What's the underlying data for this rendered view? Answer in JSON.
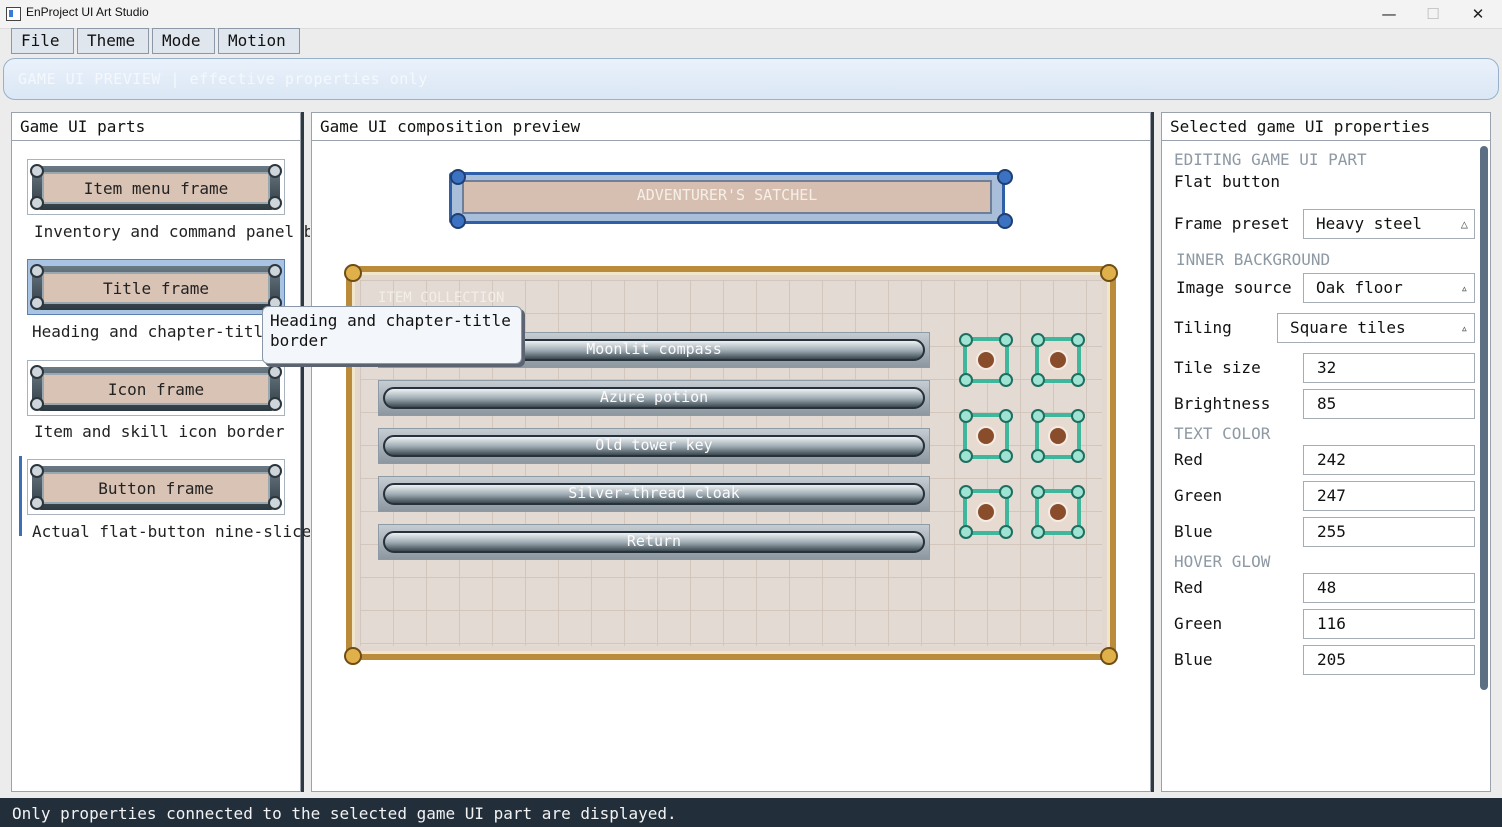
{
  "window": {
    "title": "EnProject UI Art Studio",
    "minimize": "—",
    "maximize": "☐",
    "close": "✕"
  },
  "menu": {
    "file": "File",
    "theme": "Theme",
    "mode": "Mode",
    "motion": "Motion"
  },
  "banner": "GAME UI PREVIEW  |  effective properties only",
  "parts_panel": {
    "title": "Game UI parts",
    "items": [
      {
        "label": "Item menu frame",
        "description": "Inventory and command panel border"
      },
      {
        "label": "Title frame",
        "description": "Heading and chapter-title border"
      },
      {
        "label": "Icon frame",
        "description": "Item and skill icon border"
      },
      {
        "label": "Button frame",
        "description": "Actual flat-button nine-slice border"
      }
    ],
    "tooltip": "Heading and chapter-title border"
  },
  "preview_panel": {
    "title": "Game UI composition preview",
    "title_plate": "ADVENTURER'S SATCHEL",
    "collection_label": "ITEM COLLECTION",
    "items": [
      "Moonlit compass",
      "Azure potion",
      "Old tower key",
      "Silver-thread cloak",
      "Return"
    ]
  },
  "properties_panel": {
    "title": "Selected game UI properties",
    "editing_header": "EDITING GAME UI PART",
    "editing_part": "Flat button",
    "frame_preset_label": "Frame preset",
    "frame_preset_value": "Heavy steel",
    "inner_background_header": "INNER BACKGROUND",
    "image_source_label": "Image source",
    "image_source_value": "Oak floor",
    "tiling_label": "Tiling",
    "tiling_value": "Square tiles",
    "tile_size_label": "Tile size",
    "tile_size_value": "32",
    "brightness_label": "Brightness",
    "brightness_value": "85",
    "text_color_header": "TEXT COLOR",
    "text_red_label": "Red",
    "text_red_value": "242",
    "text_green_label": "Green",
    "text_green_value": "247",
    "text_blue_label": "Blue",
    "text_blue_value": "255",
    "hover_glow_header": "HOVER GLOW",
    "hover_red_label": "Red",
    "hover_red_value": "48",
    "hover_green_label": "Green",
    "hover_green_value": "116",
    "hover_blue_label": "Blue",
    "hover_blue_value": "205"
  },
  "status": "Only properties connected to the selected game UI part are displayed."
}
